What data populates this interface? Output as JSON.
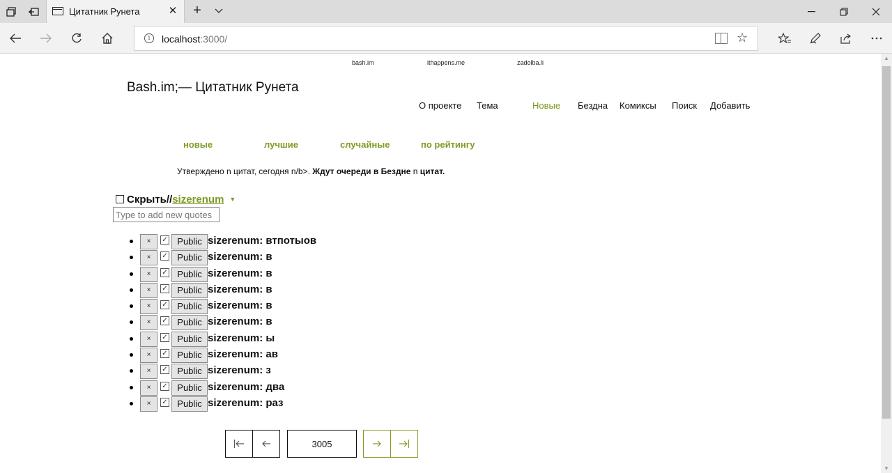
{
  "browser": {
    "tab_title": "Цитатник Рунета",
    "new_tab_symbol": "+",
    "tab_close_symbol": "✕",
    "address_host": "localhost",
    "address_path": ":3000/"
  },
  "page": {
    "top_links": [
      "bash.im",
      "ithappens.me",
      "zadolba.li"
    ],
    "site_title": "Bash.im;— Цитатник Рунета",
    "main_nav": [
      "О проекте",
      "Тема",
      "Новые",
      "Бездна",
      "Комиксы",
      "Поиск",
      "Добавить"
    ],
    "main_nav_active": "Новые",
    "sub_nav": [
      "новые",
      "лучшие",
      "случайные",
      "по рейтингу"
    ],
    "stats": {
      "part1": "Утверждено n цитат, сегодня n/b>. ",
      "part2": "Ждут очереди в Бездне ",
      "part3": "n",
      "part4": " цитат."
    },
    "hide_label": "Скрыть//",
    "username": "sizerenum",
    "new_quote_placeholder": "Type to add new quotes",
    "delete_symbol": "×",
    "public_label": "Public",
    "quotes": [
      "sizerenum: втпотыов",
      "sizerenum: в",
      "sizerenum: в",
      "sizerenum: в",
      "sizerenum: в",
      "sizerenum: в",
      "sizerenum: ы",
      "sizerenum: ав",
      "sizerenum: з",
      "sizerenum: два",
      "sizerenum: раз"
    ],
    "pager": {
      "current_page": "3005"
    }
  },
  "colors": {
    "accent": "#7f9b24",
    "text": "#111111"
  },
  "icons": {
    "first": "first-page-icon",
    "prev": "prev-page-icon",
    "next": "next-page-icon",
    "last": "last-page-icon"
  }
}
